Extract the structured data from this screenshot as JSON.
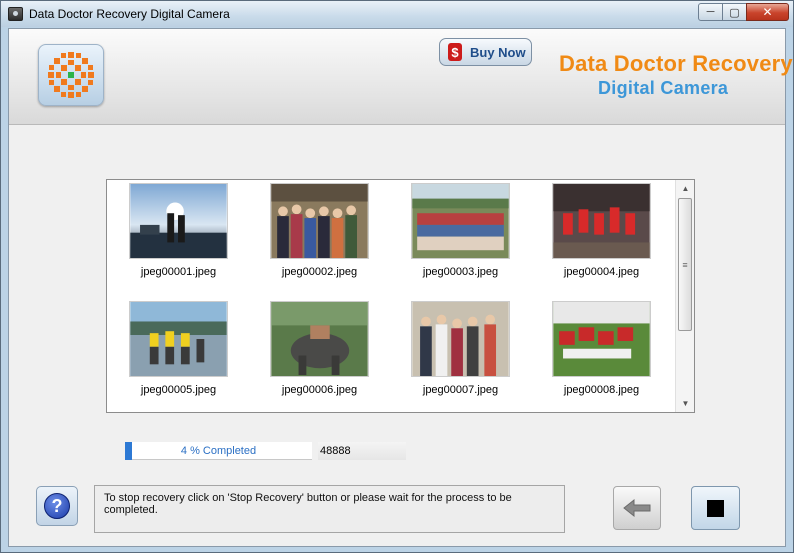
{
  "window": {
    "title": "Data Doctor Recovery Digital Camera",
    "controls": {
      "minimize": "─",
      "maximize": "▢",
      "close": "✕"
    }
  },
  "header": {
    "buy_now_label": "Buy Now",
    "buy_now_symbol": "$",
    "brand_line1": "Data Doctor Recovery",
    "brand_line2": "Digital Camera",
    "brand_color1": "#f08a15",
    "brand_color2": "#3d97d8"
  },
  "gallery": {
    "files": [
      {
        "name": "jpeg00001.jpeg",
        "icon": "photo-sunset-couple"
      },
      {
        "name": "jpeg00002.jpeg",
        "icon": "photo-group-indoor"
      },
      {
        "name": "jpeg00003.jpeg",
        "icon": "photo-large-group"
      },
      {
        "name": "jpeg00004.jpeg",
        "icon": "photo-dancers-red"
      },
      {
        "name": "jpeg00005.jpeg",
        "icon": "photo-beach-group"
      },
      {
        "name": "jpeg00006.jpeg",
        "icon": "photo-elephant-ride"
      },
      {
        "name": "jpeg00007.jpeg",
        "icon": "photo-group-standing"
      },
      {
        "name": "jpeg00008.jpeg",
        "icon": "photo-team-field"
      }
    ],
    "scroll_position": 0.0
  },
  "progress": {
    "percent": 4,
    "label": "4 % Completed",
    "count": "48888"
  },
  "status": {
    "message": "To stop recovery click on 'Stop Recovery' button or please wait for the process to be completed."
  },
  "buttons": {
    "help_symbol": "?"
  }
}
